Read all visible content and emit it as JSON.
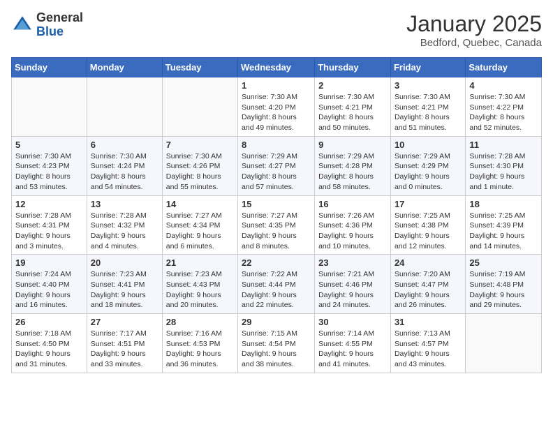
{
  "logo": {
    "general": "General",
    "blue": "Blue"
  },
  "header": {
    "month": "January 2025",
    "location": "Bedford, Quebec, Canada"
  },
  "weekdays": [
    "Sunday",
    "Monday",
    "Tuesday",
    "Wednesday",
    "Thursday",
    "Friday",
    "Saturday"
  ],
  "weeks": [
    [
      {
        "day": "",
        "info": ""
      },
      {
        "day": "",
        "info": ""
      },
      {
        "day": "",
        "info": ""
      },
      {
        "day": "1",
        "info": "Sunrise: 7:30 AM\nSunset: 4:20 PM\nDaylight: 8 hours\nand 49 minutes."
      },
      {
        "day": "2",
        "info": "Sunrise: 7:30 AM\nSunset: 4:21 PM\nDaylight: 8 hours\nand 50 minutes."
      },
      {
        "day": "3",
        "info": "Sunrise: 7:30 AM\nSunset: 4:21 PM\nDaylight: 8 hours\nand 51 minutes."
      },
      {
        "day": "4",
        "info": "Sunrise: 7:30 AM\nSunset: 4:22 PM\nDaylight: 8 hours\nand 52 minutes."
      }
    ],
    [
      {
        "day": "5",
        "info": "Sunrise: 7:30 AM\nSunset: 4:23 PM\nDaylight: 8 hours\nand 53 minutes."
      },
      {
        "day": "6",
        "info": "Sunrise: 7:30 AM\nSunset: 4:24 PM\nDaylight: 8 hours\nand 54 minutes."
      },
      {
        "day": "7",
        "info": "Sunrise: 7:30 AM\nSunset: 4:26 PM\nDaylight: 8 hours\nand 55 minutes."
      },
      {
        "day": "8",
        "info": "Sunrise: 7:29 AM\nSunset: 4:27 PM\nDaylight: 8 hours\nand 57 minutes."
      },
      {
        "day": "9",
        "info": "Sunrise: 7:29 AM\nSunset: 4:28 PM\nDaylight: 8 hours\nand 58 minutes."
      },
      {
        "day": "10",
        "info": "Sunrise: 7:29 AM\nSunset: 4:29 PM\nDaylight: 9 hours\nand 0 minutes."
      },
      {
        "day": "11",
        "info": "Sunrise: 7:28 AM\nSunset: 4:30 PM\nDaylight: 9 hours\nand 1 minute."
      }
    ],
    [
      {
        "day": "12",
        "info": "Sunrise: 7:28 AM\nSunset: 4:31 PM\nDaylight: 9 hours\nand 3 minutes."
      },
      {
        "day": "13",
        "info": "Sunrise: 7:28 AM\nSunset: 4:32 PM\nDaylight: 9 hours\nand 4 minutes."
      },
      {
        "day": "14",
        "info": "Sunrise: 7:27 AM\nSunset: 4:34 PM\nDaylight: 9 hours\nand 6 minutes."
      },
      {
        "day": "15",
        "info": "Sunrise: 7:27 AM\nSunset: 4:35 PM\nDaylight: 9 hours\nand 8 minutes."
      },
      {
        "day": "16",
        "info": "Sunrise: 7:26 AM\nSunset: 4:36 PM\nDaylight: 9 hours\nand 10 minutes."
      },
      {
        "day": "17",
        "info": "Sunrise: 7:25 AM\nSunset: 4:38 PM\nDaylight: 9 hours\nand 12 minutes."
      },
      {
        "day": "18",
        "info": "Sunrise: 7:25 AM\nSunset: 4:39 PM\nDaylight: 9 hours\nand 14 minutes."
      }
    ],
    [
      {
        "day": "19",
        "info": "Sunrise: 7:24 AM\nSunset: 4:40 PM\nDaylight: 9 hours\nand 16 minutes."
      },
      {
        "day": "20",
        "info": "Sunrise: 7:23 AM\nSunset: 4:41 PM\nDaylight: 9 hours\nand 18 minutes."
      },
      {
        "day": "21",
        "info": "Sunrise: 7:23 AM\nSunset: 4:43 PM\nDaylight: 9 hours\nand 20 minutes."
      },
      {
        "day": "22",
        "info": "Sunrise: 7:22 AM\nSunset: 4:44 PM\nDaylight: 9 hours\nand 22 minutes."
      },
      {
        "day": "23",
        "info": "Sunrise: 7:21 AM\nSunset: 4:46 PM\nDaylight: 9 hours\nand 24 minutes."
      },
      {
        "day": "24",
        "info": "Sunrise: 7:20 AM\nSunset: 4:47 PM\nDaylight: 9 hours\nand 26 minutes."
      },
      {
        "day": "25",
        "info": "Sunrise: 7:19 AM\nSunset: 4:48 PM\nDaylight: 9 hours\nand 29 minutes."
      }
    ],
    [
      {
        "day": "26",
        "info": "Sunrise: 7:18 AM\nSunset: 4:50 PM\nDaylight: 9 hours\nand 31 minutes."
      },
      {
        "day": "27",
        "info": "Sunrise: 7:17 AM\nSunset: 4:51 PM\nDaylight: 9 hours\nand 33 minutes."
      },
      {
        "day": "28",
        "info": "Sunrise: 7:16 AM\nSunset: 4:53 PM\nDaylight: 9 hours\nand 36 minutes."
      },
      {
        "day": "29",
        "info": "Sunrise: 7:15 AM\nSunset: 4:54 PM\nDaylight: 9 hours\nand 38 minutes."
      },
      {
        "day": "30",
        "info": "Sunrise: 7:14 AM\nSunset: 4:55 PM\nDaylight: 9 hours\nand 41 minutes."
      },
      {
        "day": "31",
        "info": "Sunrise: 7:13 AM\nSunset: 4:57 PM\nDaylight: 9 hours\nand 43 minutes."
      },
      {
        "day": "",
        "info": ""
      }
    ]
  ]
}
